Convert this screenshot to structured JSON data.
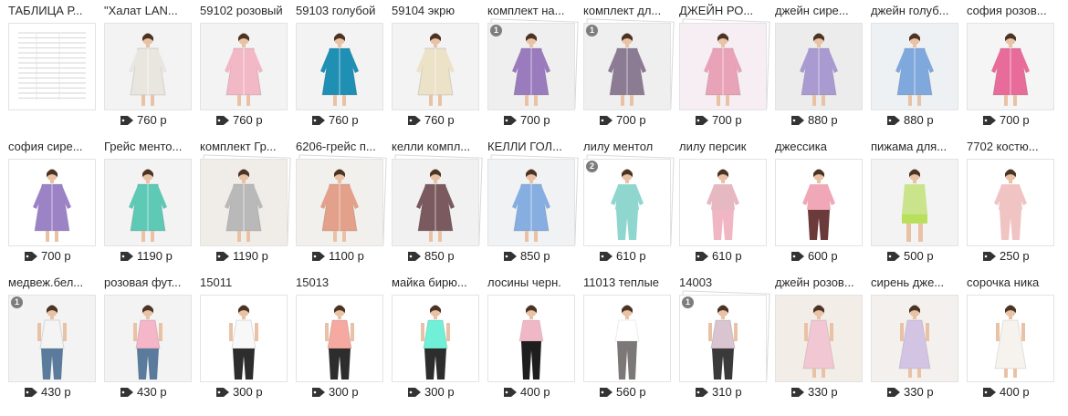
{
  "currency": "р",
  "rows": [
    [
      {
        "title": "ТАБЛИЦА Р...",
        "price": "",
        "kind": "table",
        "bg": "#ffffff"
      },
      {
        "title": "\"Халат LAN...",
        "price": "760",
        "kind": "robe",
        "color": "#e8e6df",
        "bg": "#f3f3f3"
      },
      {
        "title": "59102 розовый",
        "price": "760",
        "kind": "robe",
        "color": "#f2b8c6",
        "bg": "#f3f3f3"
      },
      {
        "title": "59103 голубой",
        "price": "760",
        "kind": "robe",
        "color": "#1f8fb3",
        "bg": "#f3f3f3"
      },
      {
        "title": "59104 экрю",
        "price": "760",
        "kind": "robe",
        "color": "#ece2c8",
        "bg": "#f3f3f3"
      },
      {
        "title": "комплект на...",
        "price": "700",
        "kind": "robe",
        "color": "#9a7bbd",
        "bg": "#efefef",
        "badge": "1",
        "stack": true
      },
      {
        "title": "комплект дл...",
        "price": "700",
        "kind": "robe",
        "color": "#8c7c93",
        "bg": "#efefef",
        "badge": "1",
        "stack": true
      },
      {
        "title": "ДЖЕЙН РО...",
        "price": "700",
        "kind": "robe",
        "color": "#e9a3b8",
        "bg": "#f6eef2",
        "stack": true
      },
      {
        "title": "джейн сире...",
        "price": "880",
        "kind": "robe",
        "color": "#a99ad1",
        "bg": "#ececec"
      },
      {
        "title": "джейн голуб...",
        "price": "880",
        "kind": "robe",
        "color": "#7fa8dc",
        "bg": "#eef1f4"
      },
      {
        "title": "софия розов...",
        "price": "700",
        "kind": "robe",
        "color": "#e86c9a",
        "bg": "#f5f5f5"
      }
    ],
    [
      {
        "title": "софия сире...",
        "price": "700",
        "kind": "robe",
        "color": "#9b83c6",
        "bg": "#ffffff"
      },
      {
        "title": "Грейс менто...",
        "price": "1190",
        "kind": "robe",
        "color": "#5ec9b4",
        "bg": "#f3f3f3"
      },
      {
        "title": "комплект Гр...",
        "price": "1190",
        "kind": "robe",
        "color": "#b9b9b9",
        "bg": "#f0ede8",
        "stack": true
      },
      {
        "title": "6206-грейс п...",
        "price": "1100",
        "kind": "robe",
        "color": "#e3a08a",
        "bg": "#f2f0ed",
        "stack": true
      },
      {
        "title": "келли компл...",
        "price": "850",
        "kind": "robe",
        "color": "#7a5a5e",
        "bg": "#f1f1f1",
        "stack": true
      },
      {
        "title": "КЕЛЛИ ГОЛ...",
        "price": "850",
        "kind": "robe",
        "color": "#86aee0",
        "bg": "#f0f2f4",
        "stack": true
      },
      {
        "title": "лилу ментол",
        "price": "610",
        "kind": "pajama",
        "color": "#8fd6cf",
        "pants": "#8fd6cf",
        "bg": "#ffffff",
        "badge": "2",
        "stack": true
      },
      {
        "title": "лилу персик",
        "price": "610",
        "kind": "pajama",
        "color": "#e6b8c2",
        "pants": "#f0b6c4",
        "bg": "#ffffff"
      },
      {
        "title": "джессика",
        "price": "600",
        "kind": "pajama",
        "color": "#f0a8b8",
        "pants": "#6b3a3a",
        "bg": "#ffffff"
      },
      {
        "title": "пижама для...",
        "price": "500",
        "kind": "shorts",
        "color": "#c9e48a",
        "pants": "#b9e05b",
        "bg": "#f3f3f3"
      },
      {
        "title": "7702 костю...",
        "price": "250",
        "kind": "pajama",
        "color": "#f1c4c4",
        "pants": "#f1c4c4",
        "bg": "#ffffff"
      }
    ],
    [
      {
        "title": "медвеж.бел...",
        "price": "430",
        "kind": "tank",
        "color": "#f4f4f4",
        "pants": "#5b7b9c",
        "bg": "#f3f3f3",
        "badge": "1"
      },
      {
        "title": "розовая фут...",
        "price": "430",
        "kind": "tank",
        "color": "#f4b6c8",
        "pants": "#5b7b9c",
        "bg": "#f3f3f3"
      },
      {
        "title": "15011",
        "price": "300",
        "kind": "tank",
        "color": "#f8f8f8",
        "pants": "#2d2d2d",
        "bg": "#ffffff"
      },
      {
        "title": "15013",
        "price": "300",
        "kind": "tank",
        "color": "#f5a9a0",
        "pants": "#2d2d2d",
        "bg": "#ffffff"
      },
      {
        "title": "майка бирю...",
        "price": "300",
        "kind": "tank",
        "color": "#6ff0d7",
        "pants": "#2d2d2d",
        "bg": "#ffffff"
      },
      {
        "title": "лосины черн.",
        "price": "400",
        "kind": "leggings",
        "color": "#f0b8c6",
        "pants": "#1e1e1e",
        "bg": "#ffffff"
      },
      {
        "title": "11013 теплые",
        "price": "560",
        "kind": "leggings",
        "color": "#ffffff",
        "pants": "#7d7878",
        "bg": "#ffffff"
      },
      {
        "title": "14003",
        "price": "310",
        "kind": "tank",
        "color": "#d9c4cf",
        "pants": "#3a3a3a",
        "bg": "#ffffff",
        "badge": "1",
        "stack": true
      },
      {
        "title": "джейн розов...",
        "price": "330",
        "kind": "dress",
        "color": "#f1c7d3",
        "bg": "#f3ede8"
      },
      {
        "title": "сирень дже...",
        "price": "330",
        "kind": "dress",
        "color": "#d3c4e4",
        "bg": "#f4f0ee"
      },
      {
        "title": "сорочка ника",
        "price": "400",
        "kind": "dress",
        "color": "#f6f3ee",
        "bg": "#ffffff"
      }
    ]
  ]
}
